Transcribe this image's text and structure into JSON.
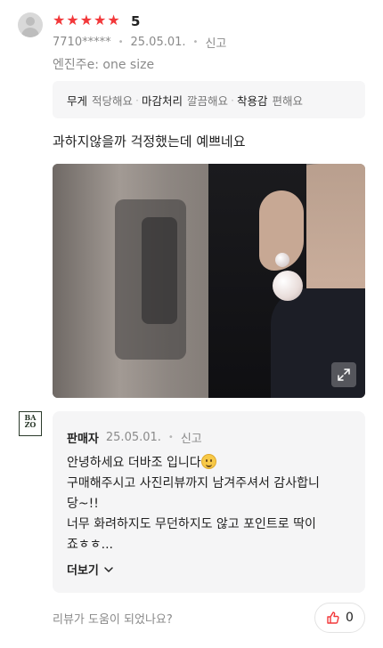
{
  "review": {
    "rating_value": 5,
    "stars": [
      "★",
      "★",
      "★",
      "★",
      "★"
    ],
    "score_label": "5",
    "user_id": "7710*****",
    "date": "25.05.01.",
    "report_label": "신고",
    "option_text": "엔진주e: one size",
    "attributes": [
      {
        "name": "무게",
        "value": "적당해요"
      },
      {
        "name": "마감처리",
        "value": "깔끔해요"
      },
      {
        "name": "착용감",
        "value": "편해요"
      }
    ],
    "text": "과하지않을까 걱정했는데 예쁘네요"
  },
  "seller_reply": {
    "logo_text": [
      "BA",
      "ZO"
    ],
    "name": "판매자",
    "date": "25.05.01.",
    "report_label": "신고",
    "lines": [
      "안녕하세요 더바조 입니다",
      "구매해주시고 사진리뷰까지 남겨주셔서 감사합니",
      "당~!!",
      "너무 화려하지도 무던하지도 않고 포인트로 딱이",
      "죠ㅎㅎ..."
    ],
    "more_label": "더보기"
  },
  "footer": {
    "helpful_question": "리뷰가 도움이 되었나요?",
    "like_count": "0"
  },
  "colors": {
    "star": "#f2383a",
    "muted_text": "#8a8a8a",
    "box_bg": "#f6f6f7"
  },
  "icons": {
    "expand": "expand-icon",
    "chevron": "chevron-down-icon",
    "thumbs_up": "thumbs-up-icon",
    "avatar": "avatar-placeholder"
  }
}
